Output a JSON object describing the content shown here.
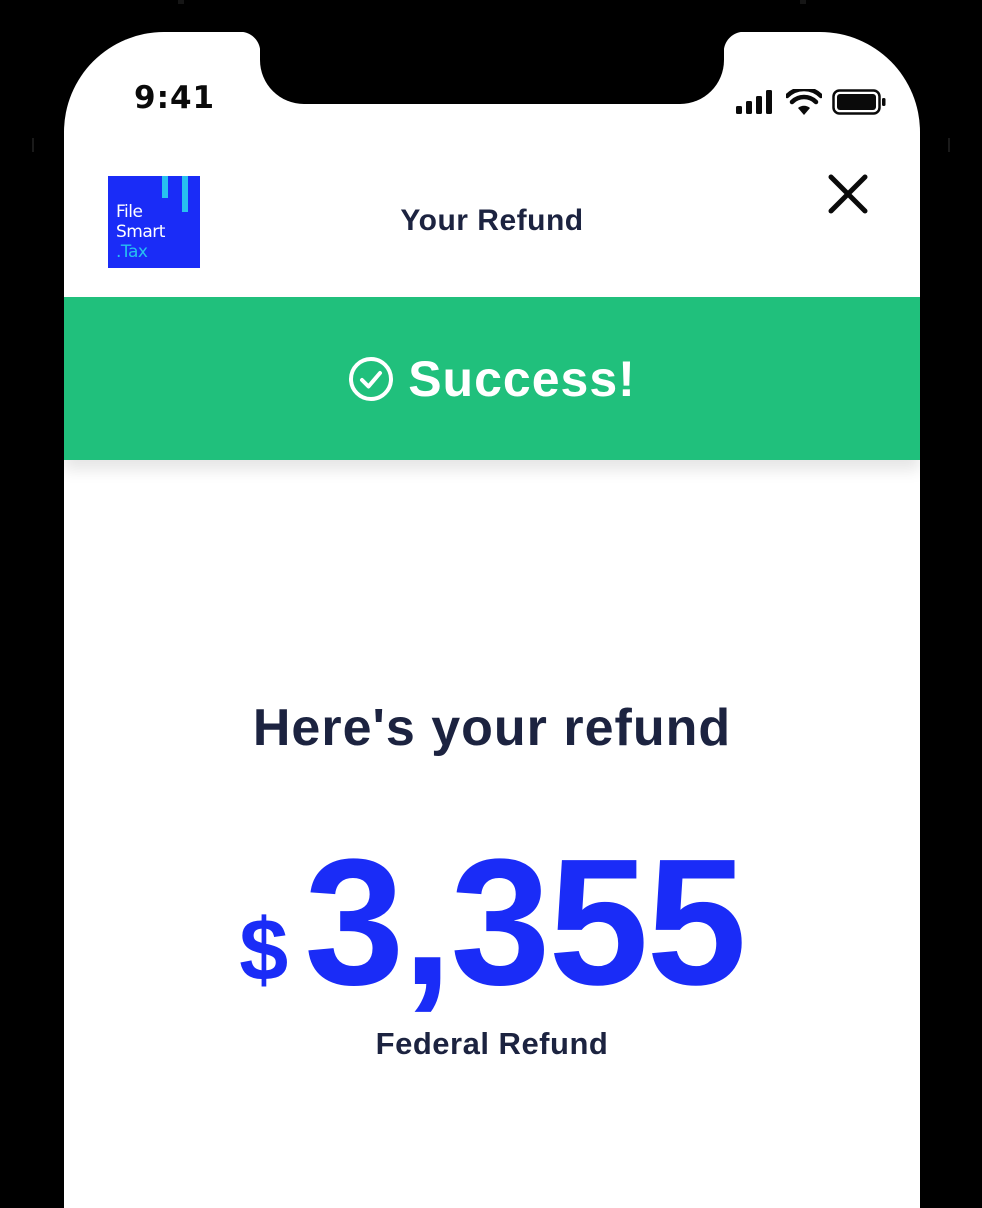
{
  "status_bar": {
    "time": "9:41",
    "icons": [
      "signal-icon",
      "wifi-icon",
      "battery-icon"
    ]
  },
  "header": {
    "logo": {
      "line1": "File",
      "line2": "Smart",
      "line3": ".Tax"
    },
    "title": "Your Refund",
    "close_icon": "close-icon"
  },
  "banner": {
    "text": "Success!",
    "icon": "check-circle-icon",
    "color": "#20c07c"
  },
  "refund": {
    "heading": "Here's your refund",
    "currency": "$",
    "amount": "3,355",
    "label": "Federal Refund"
  },
  "colors": {
    "brand_blue": "#1a2cf7",
    "accent_cyan": "#27c0f0",
    "text_dark": "#1c2340",
    "success_green": "#20c07c"
  }
}
